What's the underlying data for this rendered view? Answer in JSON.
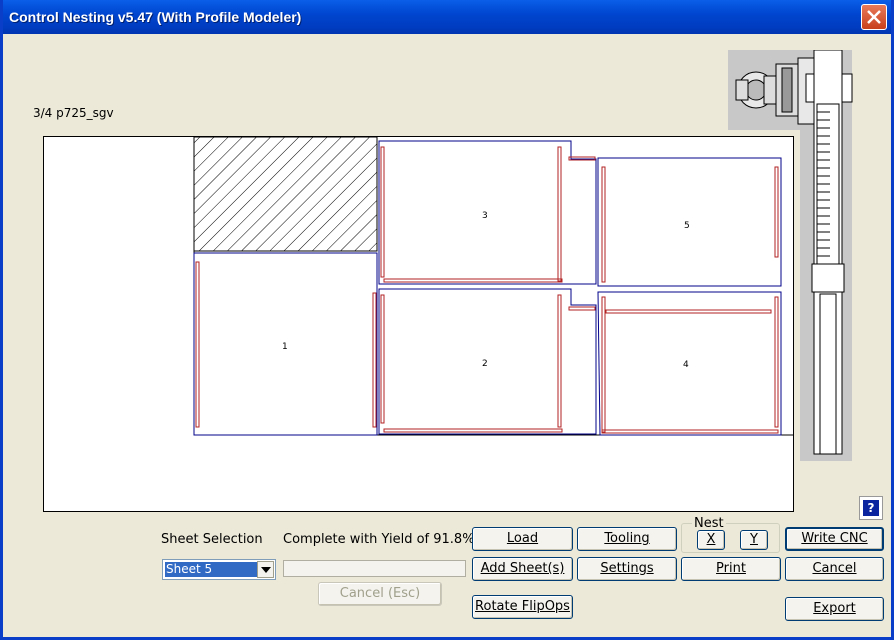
{
  "window": {
    "title": "Control Nesting v5.47 (With Profile Modeler)"
  },
  "sheet_label": "3/4 p725_sgv",
  "parts": [
    {
      "label": "1"
    },
    {
      "label": "2"
    },
    {
      "label": "3"
    },
    {
      "label": "4"
    },
    {
      "label": "5"
    }
  ],
  "controls": {
    "sheet_selection_label": "Sheet Selection",
    "sheet_selection_value": "Sheet 5",
    "status_text": "Complete with Yield of 91.8%",
    "progress": 0,
    "cancel_esc": "Cancel (Esc)",
    "load": "Load",
    "add_sheets": "Add Sheet(s)",
    "rotate_flipops": "Rotate FlipOps",
    "tooling": "Tooling",
    "settings": "Settings",
    "nest_label": "Nest",
    "nest_x": "X",
    "nest_y": "Y",
    "print": "Print",
    "write_cnc": "Write CNC",
    "cancel": "Cancel",
    "export": "Export",
    "help": "?"
  },
  "colors": {
    "title_bar": "#0046d0",
    "part_outline": "#00008b",
    "dado_line": "#b22222"
  }
}
